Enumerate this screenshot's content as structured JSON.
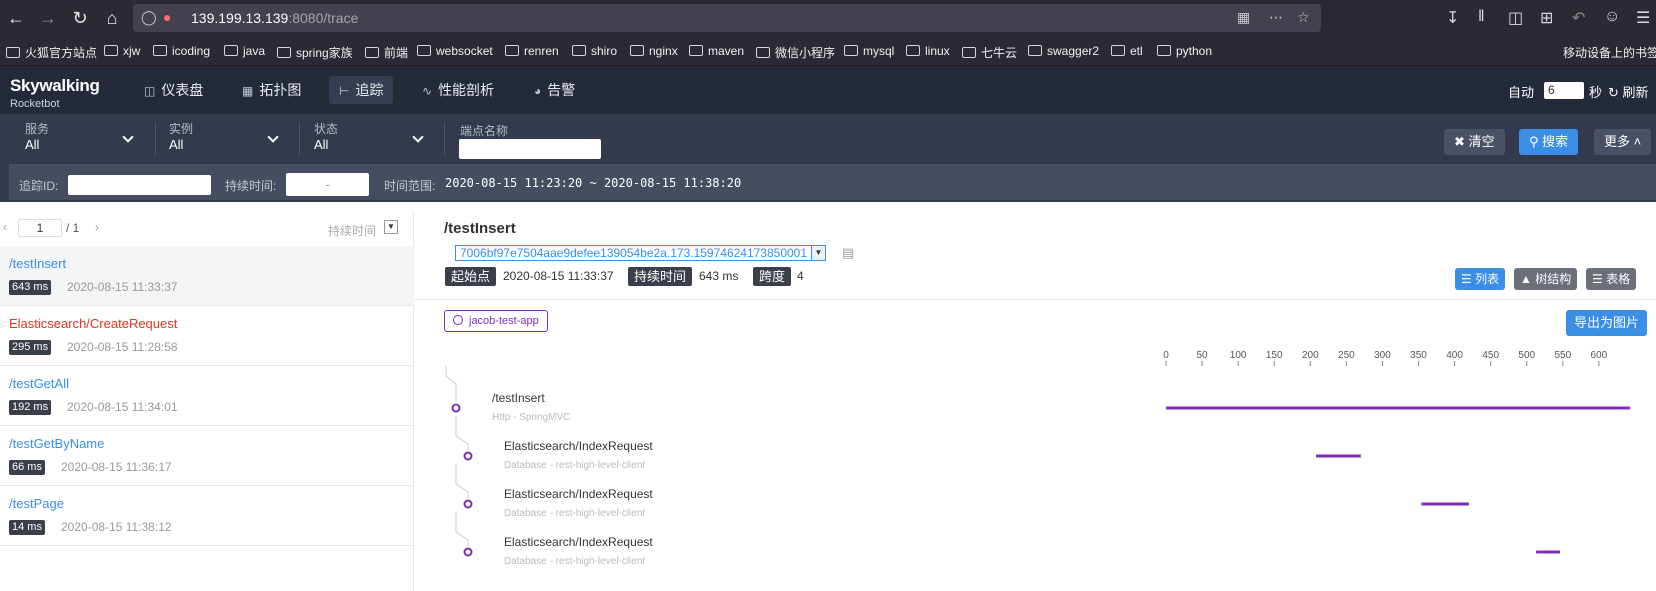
{
  "browser": {
    "url_host": "139.199.13.139",
    "url_rest": ":8080/trace",
    "bookmarks": [
      "火狐官方站点",
      "xjw",
      "icoding",
      "java",
      "spring家族",
      "前端",
      "websocket",
      "renren",
      "shiro",
      "nginx",
      "maven",
      "微信小程序",
      "mysql",
      "linux",
      "七牛云",
      "swagger2",
      "etl",
      "python"
    ],
    "mobile_bookmarks": "移动设备上的书签"
  },
  "header": {
    "logo": "Skywalking",
    "logo_sub": "Rocketbot",
    "menu": [
      "仪表盘",
      "拓扑图",
      "追踪",
      "性能剖析",
      "告警"
    ],
    "active_menu": 2,
    "auto_label": "自动",
    "interval_value": "6",
    "seconds_label": "秒",
    "refresh_label": "刷新"
  },
  "filters": {
    "service_label": "服务",
    "service_value": "All",
    "instance_label": "实例",
    "instance_value": "All",
    "status_label": "状态",
    "status_value": "All",
    "endpoint_label": "端点名称",
    "clear_label": "清空",
    "search_label": "搜索",
    "more_label": "更多",
    "trace_id_label": "追踪ID:",
    "duration_label": "持续时间:",
    "duration_placeholder": "-",
    "time_range_label": "时间范围:",
    "time_range_value": "2020-08-15 11:23:20 ~ 2020-08-15 11:38:20"
  },
  "list": {
    "page": "1",
    "page_total": "/ 1",
    "sort_label": "持续时间",
    "items": [
      {
        "endpoint": "/testInsert",
        "duration": "643 ms",
        "time": "2020-08-15 11:33:37",
        "error": false
      },
      {
        "endpoint": "Elasticsearch/CreateRequest",
        "duration": "295 ms",
        "time": "2020-08-15 11:28:58",
        "error": true
      },
      {
        "endpoint": "/testGetAll",
        "duration": "192 ms",
        "time": "2020-08-15 11:34:01",
        "error": false
      },
      {
        "endpoint": "/testGetByName",
        "duration": "66 ms",
        "time": "2020-08-15 11:36:17",
        "error": false
      },
      {
        "endpoint": "/testPage",
        "duration": "14 ms",
        "time": "2020-08-15 11:38:12",
        "error": false
      }
    ]
  },
  "detail": {
    "title": "/testInsert",
    "trace_id": "7006bf97e7504aae9defee139054be2a.173.15974624173850001",
    "start_label": "起始点",
    "start_value": "2020-08-15 11:33:37",
    "duration_label": "持续时间",
    "duration_value": "643 ms",
    "span_label": "跨度",
    "span_value": "4",
    "view_list": "列表",
    "view_tree": "树结构",
    "view_table": "表格",
    "app_name": "jacob-test-app",
    "export_label": "导出为图片",
    "axis_ticks": [
      "0",
      "50",
      "100",
      "150",
      "200",
      "250",
      "300",
      "350",
      "400",
      "450",
      "500",
      "550",
      "600"
    ],
    "span_color": "#7f2db5",
    "spans": [
      {
        "name": "/testInsert",
        "sub": "Http - SpringMVC",
        "start": 0,
        "end": 643
      },
      {
        "name": "Elasticsearch/IndexRequest",
        "sub": "Database - rest-high-level-client",
        "start": 208,
        "end": 270
      },
      {
        "name": "Elasticsearch/IndexRequest",
        "sub": "Database - rest-high-level-client",
        "start": 354,
        "end": 420
      },
      {
        "name": "Elasticsearch/IndexRequest",
        "sub": "Database - rest-high-level-client",
        "start": 513,
        "end": 546
      }
    ]
  }
}
